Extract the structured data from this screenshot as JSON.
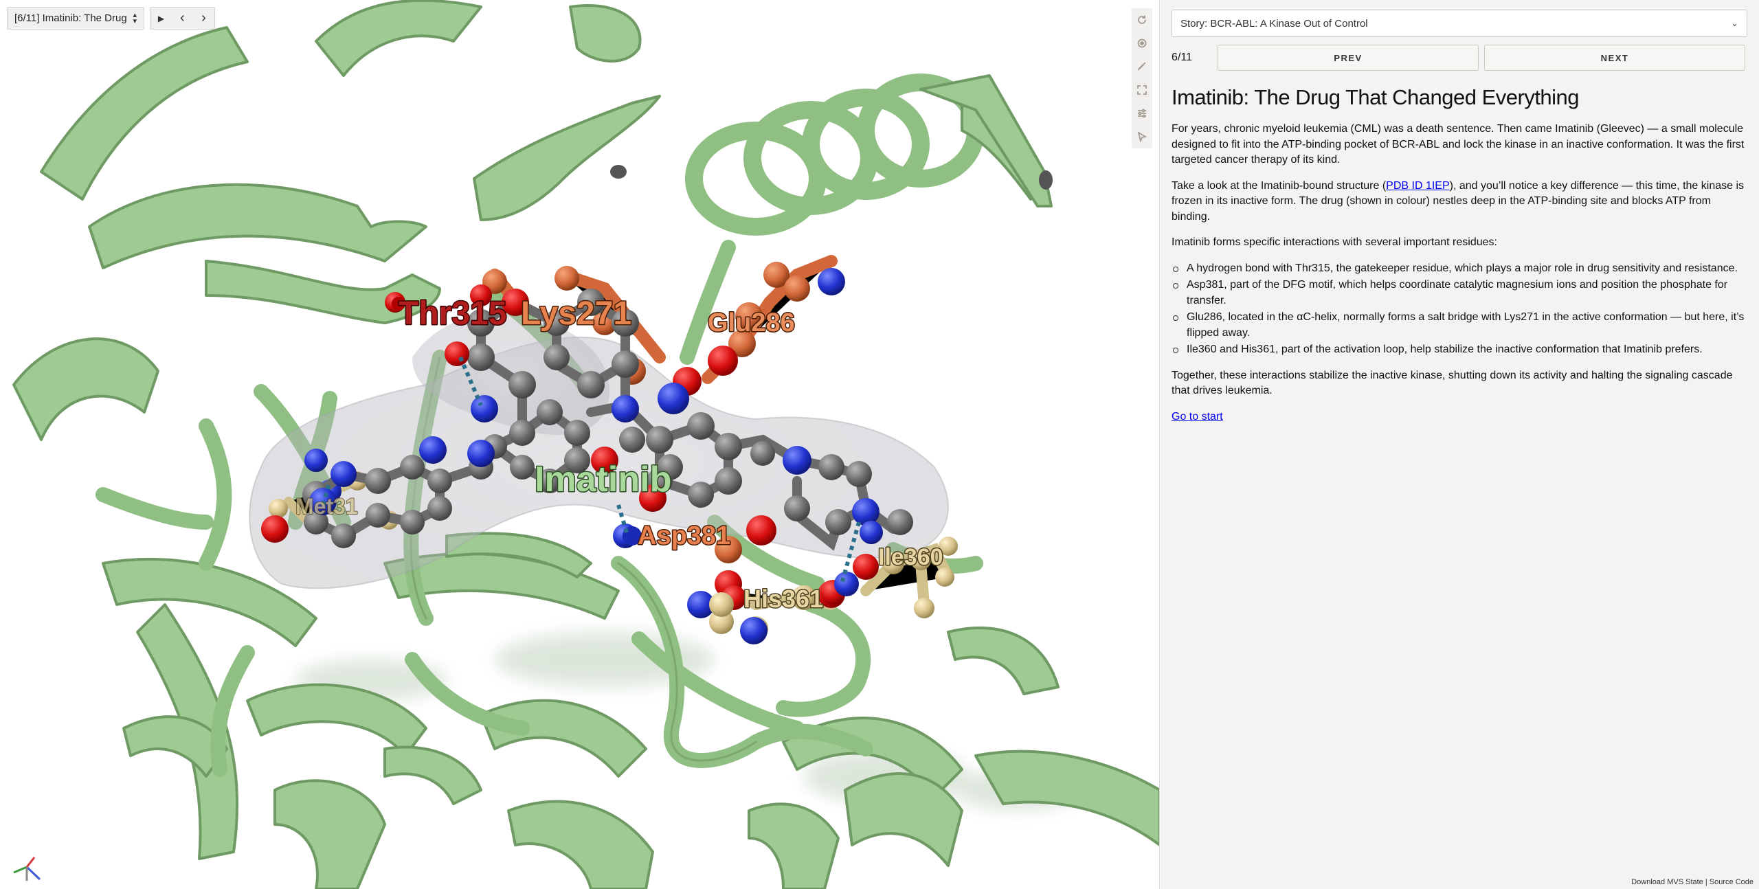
{
  "viewer": {
    "snapshot_select": "[6/11] Imatinib: The Drug T",
    "play_controls": {
      "play": "▶",
      "prev": "‹",
      "next": "›"
    },
    "tools": [
      "reset-camera-icon",
      "toggle-spin-icon",
      "measure-icon",
      "fullscreen-icon",
      "settings-icon",
      "selection-mode-icon"
    ],
    "labels": {
      "thr315": "Thr315",
      "lys271": "Lys271",
      "glu286": "Glu286",
      "imatinib": "Imatinib",
      "asp381": "Asp381",
      "his361": "His361",
      "ile360": "Ile360",
      "met318": "Met31"
    },
    "colors": {
      "cartoon": "#9ecb91",
      "carbon_drug": "#7a7a7a",
      "oxygen": "#e01818",
      "nitrogen": "#2b3fd6",
      "residue_orange": "#d9713f",
      "residue_tan": "#dcc98f",
      "surface": "#bfbfbf"
    }
  },
  "panel": {
    "story_select": "Story: BCR-ABL: A Kinase Out of Control",
    "counter": "6/11",
    "prev_label": "PREV",
    "next_label": "NEXT",
    "title": "Imatinib: The Drug That Changed Everything",
    "para1": "For years, chronic myeloid leukemia (CML) was a death sentence. Then came Imatinib (Gleevec) — a small molecule designed to fit into the ATP-binding pocket of BCR-ABL and lock the kinase in an inactive conformation. It was the first targeted cancer therapy of its kind.",
    "para2_before": "Take a look at the Imatinib-bound structure (",
    "para2_link": "PDB ID 1IEP",
    "para2_after": "), and you’ll notice a key difference — this time, the kinase is frozen in its inactive form. The drug (shown in colour) nestles deep in the ATP-binding site and blocks ATP from binding.",
    "para3": "Imatinib forms specific interactions with several important residues:",
    "bullets": [
      "A hydrogen bond with Thr315, the gatekeeper residue, which plays a major role in drug sensitivity and resistance.",
      "Asp381, part of the DFG motif, which helps coordinate catalytic magnesium ions and position the phosphate for transfer.",
      "Glu286, located in the αC-helix, normally forms a salt bridge with Lys271 in the active conformation — but here, it’s flipped away.",
      "Ile360 and His361, part of the activation loop, help stabilize the inactive conformation that Imatinib prefers."
    ],
    "para4": "Together, these interactions stabilize the inactive kinase, shutting down its activity and halting the signaling cascade that drives leukemia.",
    "go_to_start": "Go to start",
    "footer_download": "Download MVS State",
    "footer_sep": "|",
    "footer_source": "Source Code"
  }
}
